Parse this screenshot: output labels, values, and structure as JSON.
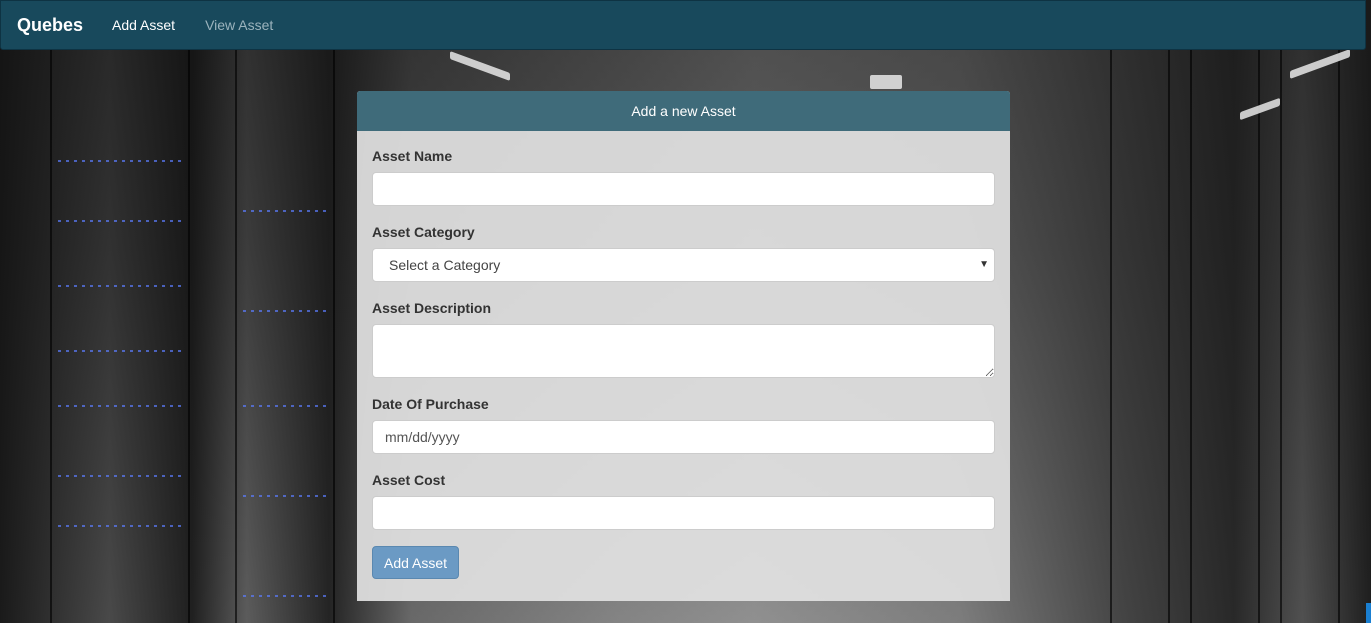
{
  "navbar": {
    "brand": "Quebes",
    "links": [
      {
        "label": "Add Asset",
        "active": true
      },
      {
        "label": "View Asset",
        "active": false
      }
    ],
    "background": "#18495c"
  },
  "panel": {
    "heading": "Add a new Asset",
    "heading_color": "#3f6b7a",
    "fields": {
      "asset_name": {
        "label": "Asset Name",
        "value": "",
        "placeholder": ""
      },
      "asset_category": {
        "label": "Asset Category",
        "selected": "Select a Category"
      },
      "asset_description": {
        "label": "Asset Description",
        "value": ""
      },
      "date_of_purchase": {
        "label": "Date Of Purchase",
        "placeholder": "mm/dd/yyyy"
      },
      "asset_cost": {
        "label": "Asset Cost",
        "value": ""
      }
    },
    "submit_label": "Add Asset",
    "button_color": "#6b9ac4"
  },
  "icons": {
    "select_arrow": "chevron-down-icon"
  }
}
